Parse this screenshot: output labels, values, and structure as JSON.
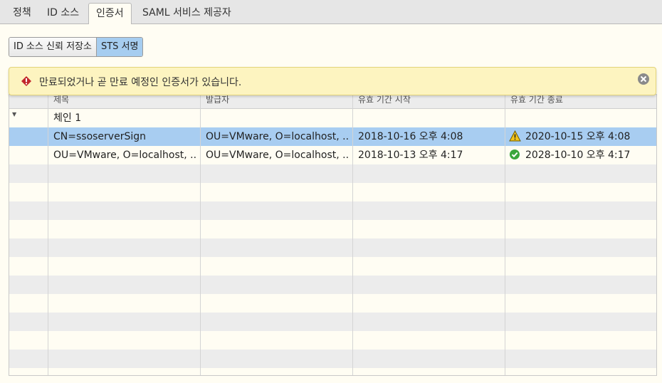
{
  "tabs": [
    {
      "label": "정책",
      "active": false
    },
    {
      "label": "ID 소스",
      "active": false
    },
    {
      "label": "인증서",
      "active": true
    },
    {
      "label": "SAML 서비스 제공자",
      "active": false
    }
  ],
  "segments": [
    {
      "label": "ID 소스 신뢰 저장소",
      "active": false
    },
    {
      "label": "STS 서명",
      "active": true
    }
  ],
  "alert": {
    "message": "만료되었거나 곧 만료 예정인 인증서가 있습니다.",
    "icon": "error-icon",
    "close_icon": "close-icon",
    "background": "#fdf4c0"
  },
  "table": {
    "columns": [
      "제목",
      "발급자",
      "유효 기간 시작",
      "유효 기간 종료"
    ],
    "group": {
      "label": "체인 1",
      "expanded": true
    },
    "rows": [
      {
        "subject": "CN=ssoserverSign",
        "issuer": "OU=VMware, O=localhost, ...",
        "valid_from": "2018-10-16 오후 4:08",
        "valid_to": "2020-10-15 오후 4:08",
        "status_icon": "warning-icon",
        "selected": true
      },
      {
        "subject": "OU=VMware, O=localhost, ...",
        "issuer": "OU=VMware, O=localhost, ...",
        "valid_from": "2018-10-13 오후 4:17",
        "valid_to": "2028-10-10 오후 4:17",
        "status_icon": "check-icon",
        "selected": false
      }
    ]
  },
  "colors": {
    "selected_row": "#a8cdf1",
    "active_segment": "#a6cdf0",
    "panel": "#fffdf3"
  }
}
